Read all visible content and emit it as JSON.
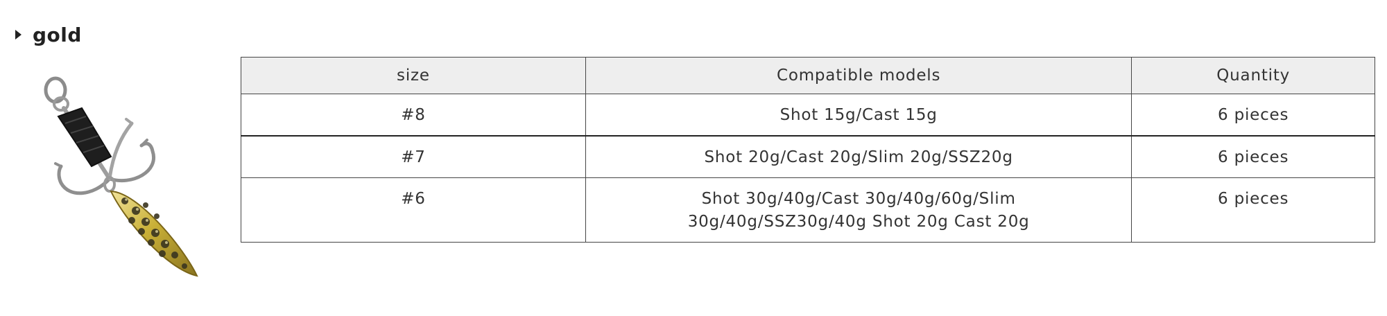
{
  "section": {
    "title": "gold",
    "caret_icon": "caret-right-icon"
  },
  "product_image": {
    "icon": "fishing-treble-hook-with-gold-spoon-blade",
    "colors": {
      "blade": "#c9b037",
      "blade_dimple": "#3a3520",
      "hook": "#9a9a9a",
      "wrap": "#1e1e1e"
    }
  },
  "table": {
    "headers": [
      "size",
      "Compatible models",
      "Quantity"
    ],
    "rows": [
      {
        "size": "#8",
        "models_line1": "Shot 15g/Cast 15g",
        "models_line2": "",
        "quantity": "6 pieces"
      },
      {
        "size": "#7",
        "models_line1": "Shot 20g/Cast 20g/Slim 20g/SSZ20g",
        "models_line2": "",
        "quantity": "6 pieces"
      },
      {
        "size": "#6",
        "models_line1": "Shot 30g/40g/Cast 30g/40g/60g/Slim",
        "models_line2": "30g/40g/SSZ30g/40g Shot 20g Cast 20g",
        "quantity": "6 pieces"
      }
    ]
  }
}
